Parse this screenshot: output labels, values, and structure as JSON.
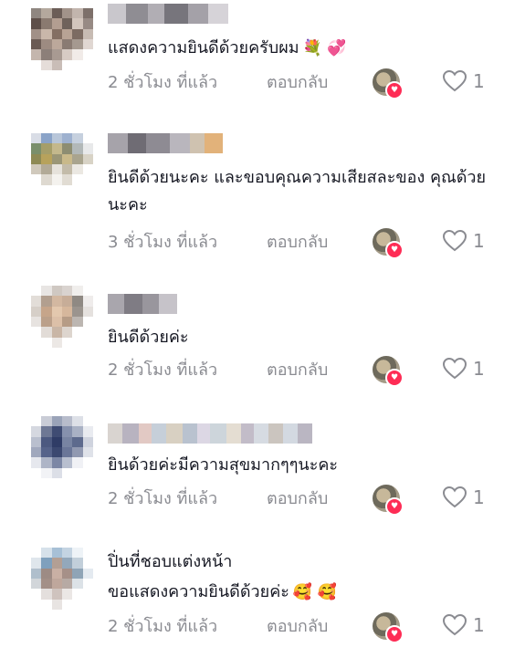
{
  "comments": [
    {
      "text": "แสดงความยินดีด้วยครับผม",
      "emoji": "💐 💞",
      "time": "2 ชั่วโมง ที่แล้ว",
      "reply": "ตอบกลับ",
      "likes": "1"
    },
    {
      "text": "ยินดีด้วยนะคะ และขอบคุณความเสียสละของ คุณด้วยนะคะ",
      "emoji": "",
      "time": "3 ชั่วโมง ที่แล้ว",
      "reply": "ตอบกลับ",
      "likes": "1"
    },
    {
      "text": "ยินดีด้วยค่ะ",
      "emoji": "",
      "time": "2 ชั่วโมง ที่แล้ว",
      "reply": "ตอบกลับ",
      "likes": "1"
    },
    {
      "text": "ยินด้วยค่ะมีความสุขมากๆๆนะคะ",
      "emoji": "",
      "time": "2 ชั่วโมง ที่แล้ว",
      "reply": "ตอบกลับ",
      "likes": "1"
    },
    {
      "username": "ปิ่นที่ชอบแต่งหน้า",
      "text": "ขอแสดงความยินดีด้วยค่ะ",
      "emoji": "🥰 🥰",
      "time": "2 ชั่วโมง ที่แล้ว",
      "reply": "ตอบกลับ",
      "likes": "1"
    }
  ],
  "colors": {
    "text": "#161823",
    "meta": "#8a8b91",
    "creator_heart": "#fe2c55"
  },
  "icons": {
    "like": "heart-outline-icon",
    "creator_badge": "creator-liked-icon"
  }
}
